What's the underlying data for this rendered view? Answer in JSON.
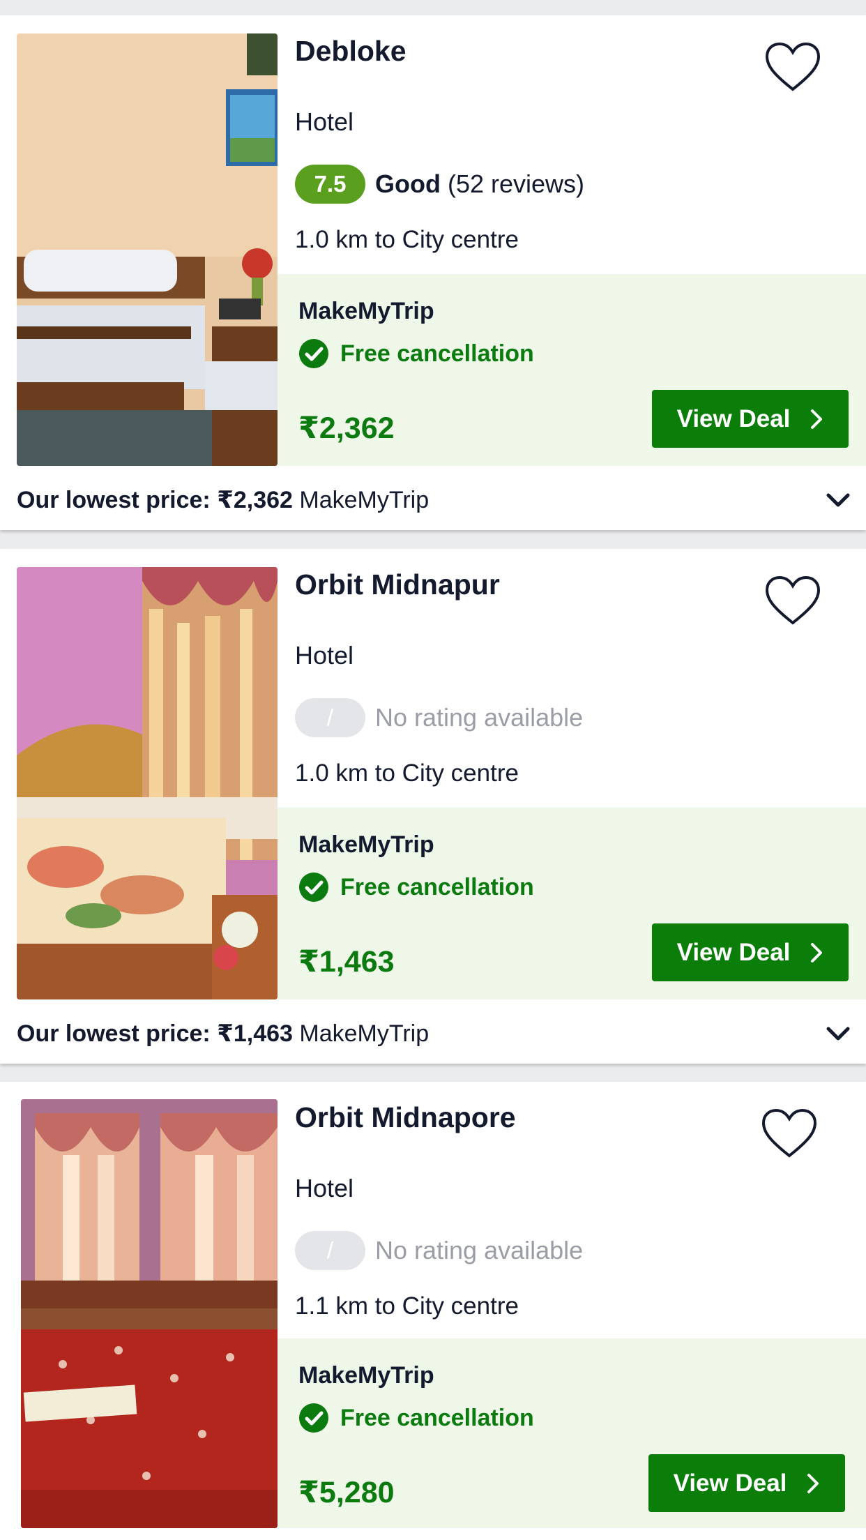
{
  "colors": {
    "background": "#ebecee",
    "deal_panel": "#eff7e8",
    "button": "#0b7e0a",
    "price_text": "#0b7a0f",
    "good_rating": "#5aa01e",
    "no_rating": "#e3e5e8"
  },
  "hotels": [
    {
      "name": "Debloke",
      "type": "Hotel",
      "rating_score": "7.5",
      "rating_label": "Good",
      "rating_reviews": "(52 reviews)",
      "distance": "1.0 km to City centre",
      "provider": "MakeMyTrip",
      "cancellation": "Free cancellation",
      "price": "₹2,362",
      "button_label": "View Deal",
      "lowest_label": "Our lowest price:",
      "lowest_price": "₹2,362",
      "lowest_provider": "MakeMyTrip"
    },
    {
      "name": "Orbit Midnapur",
      "type": "Hotel",
      "rating_score": "/",
      "rating_none": "No rating available",
      "distance": "1.0 km to City centre",
      "provider": "MakeMyTrip",
      "cancellation": "Free cancellation",
      "price": "₹1,463",
      "button_label": "View Deal",
      "lowest_label": "Our lowest price:",
      "lowest_price": "₹1,463",
      "lowest_provider": "MakeMyTrip"
    },
    {
      "name": "Orbit Midnapore",
      "type": "Hotel",
      "rating_score": "/",
      "rating_none": "No rating available",
      "distance": "1.1 km to City centre",
      "provider": "MakeMyTrip",
      "cancellation": "Free cancellation",
      "price": "₹5,280",
      "button_label": "View Deal"
    }
  ],
  "icons": [
    "heart-outline-icon",
    "check-circle-icon",
    "chevron-right-icon",
    "chevron-down-icon"
  ]
}
